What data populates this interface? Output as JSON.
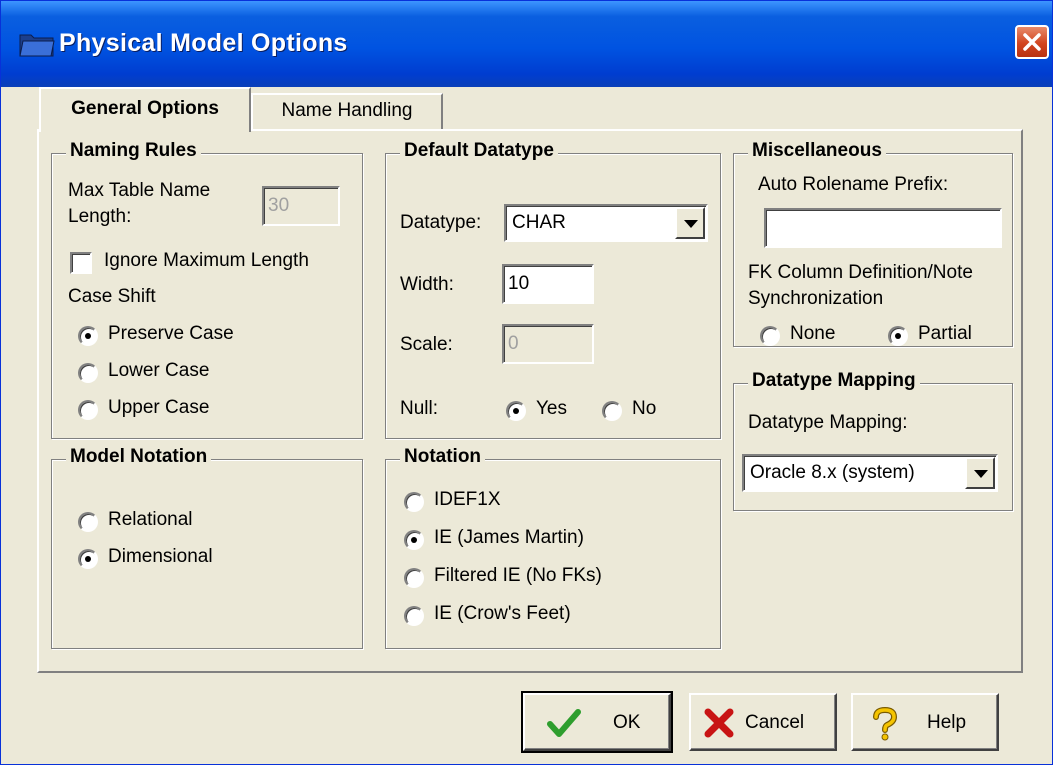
{
  "window": {
    "title": "Physical Model Options"
  },
  "tabs": [
    {
      "label": "General Options",
      "active": true
    },
    {
      "label": "Name Handling",
      "active": false
    }
  ],
  "naming_rules": {
    "title": "Naming Rules",
    "max_len_label_1": "Max Table Name",
    "max_len_label_2": "Length:",
    "max_len_value": "30",
    "ignore_max_label": "Ignore Maximum Length",
    "ignore_max_checked": false,
    "case_shift_label": "Case Shift",
    "case_options": [
      {
        "label": "Preserve Case",
        "selected": true
      },
      {
        "label": "Lower Case",
        "selected": false
      },
      {
        "label": "Upper Case",
        "selected": false
      }
    ]
  },
  "default_datatype": {
    "title": "Default Datatype",
    "datatype_label": "Datatype:",
    "datatype_value": "CHAR",
    "width_label": "Width:",
    "width_value": "10",
    "scale_label": "Scale:",
    "scale_value": "0",
    "null_label": "Null:",
    "null_options": [
      {
        "label": "Yes",
        "selected": true
      },
      {
        "label": "No",
        "selected": false
      }
    ]
  },
  "miscellaneous": {
    "title": "Miscellaneous",
    "prefix_label": "Auto Rolename Prefix:",
    "prefix_value": "",
    "fk_label_1": "FK Column Definition/Note",
    "fk_label_2": "Synchronization",
    "fk_options": [
      {
        "label": "None",
        "selected": false
      },
      {
        "label": "Partial",
        "selected": true
      }
    ]
  },
  "datatype_mapping": {
    "title": "Datatype Mapping",
    "label": "Datatype Mapping:",
    "value": "Oracle 8.x (system)"
  },
  "model_notation": {
    "title": "Model Notation",
    "options": [
      {
        "label": "Relational",
        "selected": false
      },
      {
        "label": "Dimensional",
        "selected": true
      }
    ]
  },
  "notation": {
    "title": "Notation",
    "options": [
      {
        "label": "IDEF1X",
        "selected": false
      },
      {
        "label": "IE (James Martin)",
        "selected": true
      },
      {
        "label": "Filtered IE (No FKs)",
        "selected": false
      },
      {
        "label": "IE (Crow's Feet)",
        "selected": false
      }
    ]
  },
  "buttons": {
    "ok": "OK",
    "cancel": "Cancel",
    "help": "Help"
  },
  "colors": {
    "title_bar": "#0053e1",
    "face": "#ece9d8",
    "close": "#d2451f"
  }
}
